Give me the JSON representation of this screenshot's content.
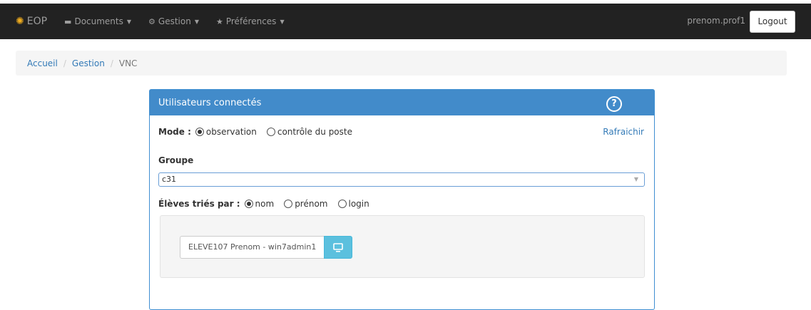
{
  "navbar": {
    "brand_icon": "sun-icon",
    "brand": "EOP",
    "menus": [
      {
        "icon": "folder-icon",
        "label": "Documents"
      },
      {
        "icon": "gears-icon",
        "label": "Gestion"
      },
      {
        "icon": "star-icon",
        "label": "Préférences"
      }
    ],
    "user": "prenom.prof1",
    "logout": "Logout"
  },
  "breadcrumb": [
    "Accueil",
    "Gestion",
    "VNC"
  ],
  "panel": {
    "title": "Utilisateurs connectés",
    "help_icon": "?",
    "mode_label": "Mode :",
    "mode_options": [
      {
        "label": "observation",
        "checked": true
      },
      {
        "label": "contrôle du poste",
        "checked": false
      }
    ],
    "refresh": "Rafraichir",
    "group_label": "Groupe",
    "group_value": "c31",
    "sort_label": "Élèves triés par :",
    "sort_options": [
      {
        "label": "nom",
        "checked": true
      },
      {
        "label": "prénom",
        "checked": false
      },
      {
        "label": "login",
        "checked": false
      }
    ],
    "students": [
      {
        "label": "ELEVE107 Prenom - win7admin1",
        "button_icon": "monitor-icon"
      }
    ]
  },
  "colors": {
    "navbar": "#222222",
    "panel_header": "#428bca",
    "link": "#337ab7",
    "info_button": "#5bc0de",
    "brand_icon": "#f0ad1e"
  }
}
